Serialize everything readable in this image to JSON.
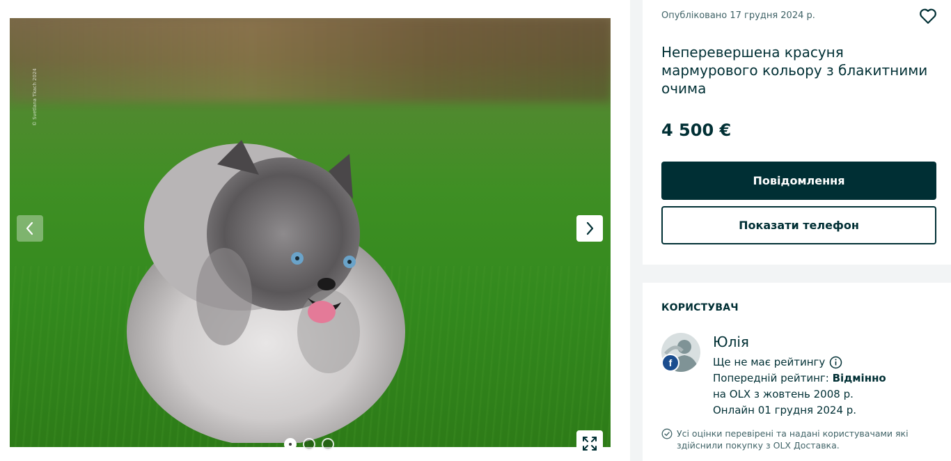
{
  "gallery": {
    "watermark": "© Svetlana Tkach 2024",
    "slides_total": 3,
    "active_slide": 1
  },
  "listing": {
    "posted": "Опубліковано 17 грудня 2024 р.",
    "title": "Неперевершена красуня мармурового кольору з блакитними очима",
    "price": "4 500 €",
    "message_button": "Повідомлення",
    "phone_button": "Показати телефон"
  },
  "user": {
    "heading": "КОРИСТУВАЧ",
    "name": "Юлія",
    "no_rating": "Ще не має рейтингу",
    "prev_rating_label": "Попередній рейтинг: ",
    "prev_rating_value": "Відмінно",
    "since": "на OLX з жовтень 2008 р.",
    "online": "Онлайн 01 грудня 2024 р.",
    "verified_note": "Усі оцінки перевірені та надані користувачами які здійснили покупку з OLX Доставка."
  },
  "colors": {
    "primary": "#002f34",
    "background": "#f2f4f5",
    "facebook": "#1b4d8f"
  }
}
